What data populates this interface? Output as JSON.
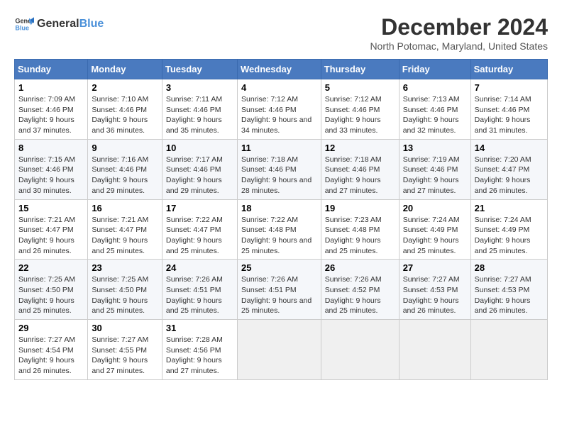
{
  "logo": {
    "text_general": "General",
    "text_blue": "Blue"
  },
  "title": "December 2024",
  "subtitle": "North Potomac, Maryland, United States",
  "days_of_week": [
    "Sunday",
    "Monday",
    "Tuesday",
    "Wednesday",
    "Thursday",
    "Friday",
    "Saturday"
  ],
  "weeks": [
    [
      {
        "day": "1",
        "sunrise": "7:09 AM",
        "sunset": "4:46 PM",
        "daylight": "9 hours and 37 minutes."
      },
      {
        "day": "2",
        "sunrise": "7:10 AM",
        "sunset": "4:46 PM",
        "daylight": "9 hours and 36 minutes."
      },
      {
        "day": "3",
        "sunrise": "7:11 AM",
        "sunset": "4:46 PM",
        "daylight": "9 hours and 35 minutes."
      },
      {
        "day": "4",
        "sunrise": "7:12 AM",
        "sunset": "4:46 PM",
        "daylight": "9 hours and 34 minutes."
      },
      {
        "day": "5",
        "sunrise": "7:12 AM",
        "sunset": "4:46 PM",
        "daylight": "9 hours and 33 minutes."
      },
      {
        "day": "6",
        "sunrise": "7:13 AM",
        "sunset": "4:46 PM",
        "daylight": "9 hours and 32 minutes."
      },
      {
        "day": "7",
        "sunrise": "7:14 AM",
        "sunset": "4:46 PM",
        "daylight": "9 hours and 31 minutes."
      }
    ],
    [
      {
        "day": "8",
        "sunrise": "7:15 AM",
        "sunset": "4:46 PM",
        "daylight": "9 hours and 30 minutes."
      },
      {
        "day": "9",
        "sunrise": "7:16 AM",
        "sunset": "4:46 PM",
        "daylight": "9 hours and 29 minutes."
      },
      {
        "day": "10",
        "sunrise": "7:17 AM",
        "sunset": "4:46 PM",
        "daylight": "9 hours and 29 minutes."
      },
      {
        "day": "11",
        "sunrise": "7:18 AM",
        "sunset": "4:46 PM",
        "daylight": "9 hours and 28 minutes."
      },
      {
        "day": "12",
        "sunrise": "7:18 AM",
        "sunset": "4:46 PM",
        "daylight": "9 hours and 27 minutes."
      },
      {
        "day": "13",
        "sunrise": "7:19 AM",
        "sunset": "4:46 PM",
        "daylight": "9 hours and 27 minutes."
      },
      {
        "day": "14",
        "sunrise": "7:20 AM",
        "sunset": "4:47 PM",
        "daylight": "9 hours and 26 minutes."
      }
    ],
    [
      {
        "day": "15",
        "sunrise": "7:21 AM",
        "sunset": "4:47 PM",
        "daylight": "9 hours and 26 minutes."
      },
      {
        "day": "16",
        "sunrise": "7:21 AM",
        "sunset": "4:47 PM",
        "daylight": "9 hours and 25 minutes."
      },
      {
        "day": "17",
        "sunrise": "7:22 AM",
        "sunset": "4:47 PM",
        "daylight": "9 hours and 25 minutes."
      },
      {
        "day": "18",
        "sunrise": "7:22 AM",
        "sunset": "4:48 PM",
        "daylight": "9 hours and 25 minutes."
      },
      {
        "day": "19",
        "sunrise": "7:23 AM",
        "sunset": "4:48 PM",
        "daylight": "9 hours and 25 minutes."
      },
      {
        "day": "20",
        "sunrise": "7:24 AM",
        "sunset": "4:49 PM",
        "daylight": "9 hours and 25 minutes."
      },
      {
        "day": "21",
        "sunrise": "7:24 AM",
        "sunset": "4:49 PM",
        "daylight": "9 hours and 25 minutes."
      }
    ],
    [
      {
        "day": "22",
        "sunrise": "7:25 AM",
        "sunset": "4:50 PM",
        "daylight": "9 hours and 25 minutes."
      },
      {
        "day": "23",
        "sunrise": "7:25 AM",
        "sunset": "4:50 PM",
        "daylight": "9 hours and 25 minutes."
      },
      {
        "day": "24",
        "sunrise": "7:26 AM",
        "sunset": "4:51 PM",
        "daylight": "9 hours and 25 minutes."
      },
      {
        "day": "25",
        "sunrise": "7:26 AM",
        "sunset": "4:51 PM",
        "daylight": "9 hours and 25 minutes."
      },
      {
        "day": "26",
        "sunrise": "7:26 AM",
        "sunset": "4:52 PM",
        "daylight": "9 hours and 25 minutes."
      },
      {
        "day": "27",
        "sunrise": "7:27 AM",
        "sunset": "4:53 PM",
        "daylight": "9 hours and 26 minutes."
      },
      {
        "day": "28",
        "sunrise": "7:27 AM",
        "sunset": "4:53 PM",
        "daylight": "9 hours and 26 minutes."
      }
    ],
    [
      {
        "day": "29",
        "sunrise": "7:27 AM",
        "sunset": "4:54 PM",
        "daylight": "9 hours and 26 minutes."
      },
      {
        "day": "30",
        "sunrise": "7:27 AM",
        "sunset": "4:55 PM",
        "daylight": "9 hours and 27 minutes."
      },
      {
        "day": "31",
        "sunrise": "7:28 AM",
        "sunset": "4:56 PM",
        "daylight": "9 hours and 27 minutes."
      },
      null,
      null,
      null,
      null
    ]
  ],
  "labels": {
    "sunrise": "Sunrise:",
    "sunset": "Sunset:",
    "daylight": "Daylight:"
  }
}
